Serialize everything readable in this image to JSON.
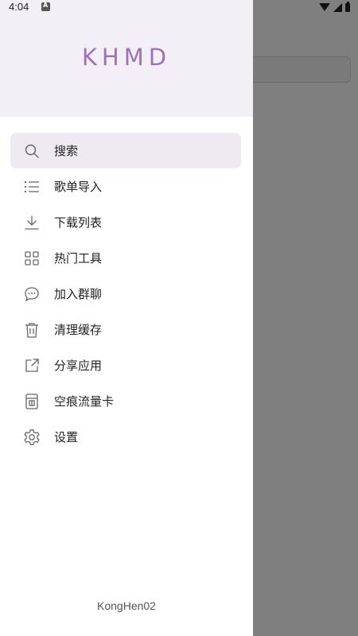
{
  "status_bar": {
    "time": "4:04"
  },
  "drawer": {
    "logo": "KHMD",
    "items": [
      {
        "label": "搜索",
        "icon": "search-icon",
        "active": true
      },
      {
        "label": "歌单导入",
        "icon": "list-icon"
      },
      {
        "label": "下载列表",
        "icon": "download-icon"
      },
      {
        "label": "热门工具",
        "icon": "grid-icon"
      },
      {
        "label": "加入群聊",
        "icon": "chat-bubble-icon"
      },
      {
        "label": "清理缓存",
        "icon": "trash-icon"
      },
      {
        "label": "分享应用",
        "icon": "share-icon"
      },
      {
        "label": "空痕流量卡",
        "icon": "sim-card-icon"
      },
      {
        "label": "设置",
        "icon": "gear-icon"
      }
    ],
    "footer_user": "KongHen02"
  },
  "colors": {
    "header_bg": "#f4eff6",
    "logo": "#9c73b4",
    "active_item_bg": "#efe9f1",
    "scrim": "#7f7f7f"
  }
}
